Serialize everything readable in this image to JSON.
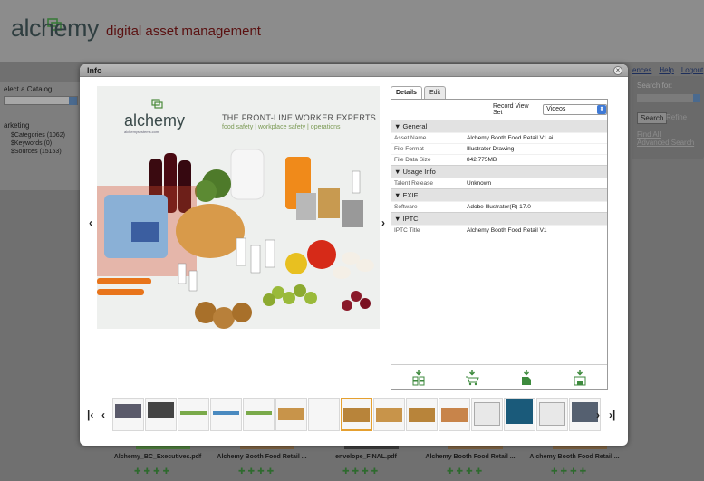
{
  "app": {
    "logo_text": "alchemy",
    "logo_sub": "digital asset management"
  },
  "left_panel": {
    "catalog_label": "elect a Catalog:",
    "section_label": "arketing",
    "items": [
      "$Categories (1062)",
      "$Keywords (0)",
      "$Sources (15153)"
    ]
  },
  "top_links": [
    "ences",
    "Help",
    "Logout"
  ],
  "search_panel": {
    "title": "Search for:",
    "search_button": "Search",
    "refine": "Refine",
    "find_all": "Find All",
    "advanced": "Advanced Search"
  },
  "bottom_items": [
    {
      "title": "Alchemy_BC_Executives.pdf"
    },
    {
      "title": "Alchemy Booth Food Retail ..."
    },
    {
      "title": "envelope_FINAL.pdf"
    },
    {
      "title": "Alchemy Booth Food Retail ..."
    },
    {
      "title": "Alchemy Booth Food Retail ..."
    }
  ],
  "modal": {
    "title": "Info",
    "close": "×",
    "prev": "‹",
    "next": "›",
    "preview": {
      "logo": "alchemy",
      "logo_url": "alchemysystems.com",
      "headline": "THE FRONT-LINE WORKER EXPERTS",
      "subline": "food safety | workplace safety | operations"
    },
    "tabs": [
      {
        "label": "Details",
        "active": true
      },
      {
        "label": "Edit",
        "active": false
      }
    ],
    "record_view_label": "Record View Set",
    "record_view_value": "Videos",
    "sections": [
      {
        "name": "General",
        "rows": [
          {
            "k": "Asset Name",
            "v": "Alchemy Booth Food Retail V1.ai"
          },
          {
            "k": "File Format",
            "v": "Illustrator Drawing"
          },
          {
            "k": "File Data Size",
            "v": "842.775MB"
          }
        ]
      },
      {
        "name": "Usage Info",
        "rows": [
          {
            "k": "Talent Release",
            "v": "Unknown"
          }
        ]
      },
      {
        "name": "EXIF",
        "rows": [
          {
            "k": "Software",
            "v": "Adobe Illustrator(R) 17.0"
          }
        ]
      },
      {
        "name": "IPTC",
        "rows": [
          {
            "k": "IPTC Title",
            "v": "Alchemy Booth Food Retail V1"
          }
        ]
      }
    ],
    "actions": [
      "add-to-lightbox-icon",
      "add-to-cart-icon",
      "download-icon",
      "save-icon"
    ],
    "thumb_nav": {
      "first": "|‹",
      "prev": "‹",
      "next": "›",
      "last": "›|"
    },
    "thumb_selected_index": 7,
    "thumb_count": 15
  },
  "colors": {
    "accent_green": "#3d8a3d",
    "select_blue": "#3f7ad6",
    "selected_thumb": "#e5a030"
  }
}
